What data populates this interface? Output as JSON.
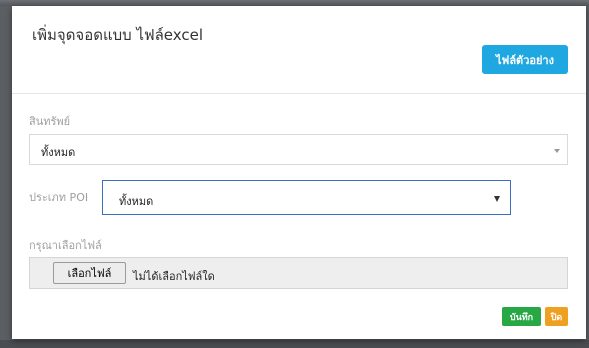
{
  "modal": {
    "title": "เพิ่มจุดจอดแบบ ไฟล์excel",
    "sample_button": "ไฟล์ตัวอย่าง"
  },
  "asset": {
    "label": "สินทรัพย์",
    "selected": "ทั้งหมด"
  },
  "poi_type": {
    "label": "ประเภท POI",
    "selected": "ทั้งหมด"
  },
  "file": {
    "label": "กรุณาเลือกไฟล์",
    "button": "เลือกไฟล์",
    "status": "ไม่ได้เลือกไฟล์ใด"
  },
  "footer": {
    "save_label": "บันทึก",
    "close_label": "ปิด"
  },
  "colors": {
    "sample_button": "#1ea7e1",
    "save_button": "#27a844",
    "close_button": "#f0a020"
  }
}
